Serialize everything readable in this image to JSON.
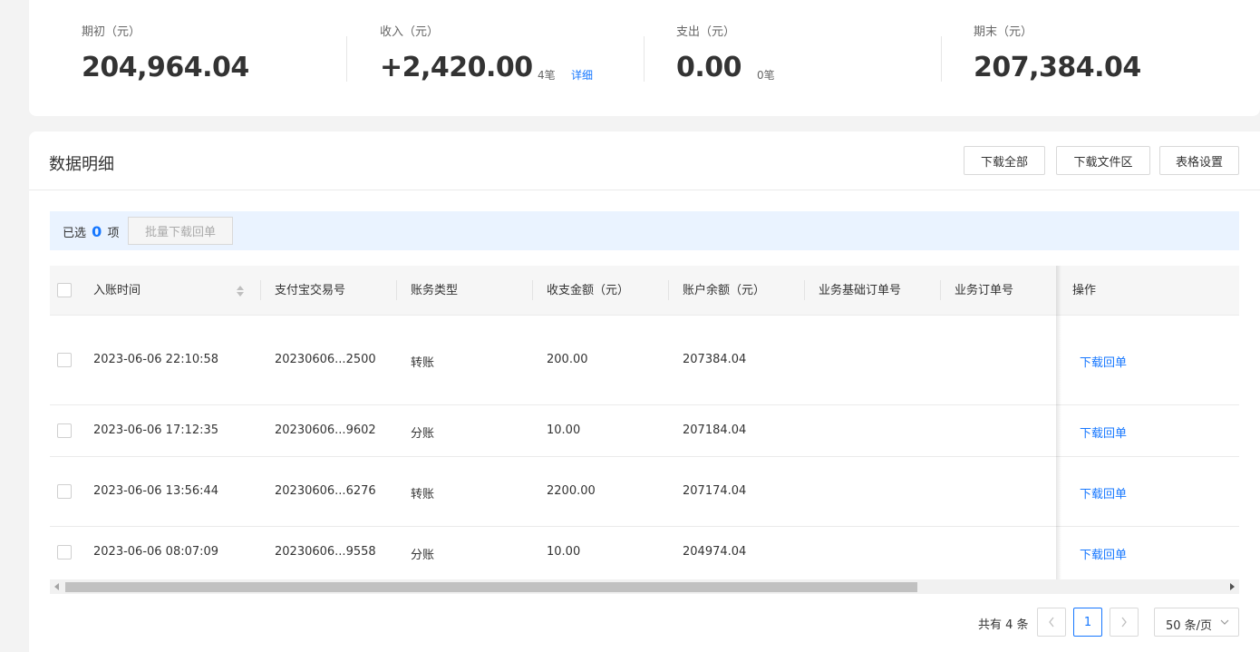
{
  "summary": [
    {
      "label": "期初（元）",
      "value": "204,964.04"
    },
    {
      "label": "收入（元）",
      "value": "+2,420.00",
      "count": "4笔",
      "detail": "详细"
    },
    {
      "label": "支出（元）",
      "value": "0.00",
      "count": "0笔"
    },
    {
      "label": "期末（元）",
      "value": "207,384.04"
    }
  ],
  "section": {
    "title": "数据明细",
    "buttons": [
      "下载全部",
      "下载文件区",
      "表格设置"
    ]
  },
  "selection": {
    "prefix": "已选",
    "count": "0",
    "suffix": "项",
    "batch_button": "批量下载回单"
  },
  "table": {
    "columns": [
      "入账时间",
      "支付宝交易号",
      "账务类型",
      "收支金额（元）",
      "账户余额（元）",
      "业务基础订单号",
      "业务订单号",
      "操作"
    ],
    "rows": [
      {
        "time": "2023-06-06 22:10:58",
        "trade_no": "20230606...2500",
        "type": "转账",
        "amount": "200.00",
        "balance": "207384.04",
        "base_order": "",
        "order": "",
        "action": "下载回单"
      },
      {
        "time": "2023-06-06 17:12:35",
        "trade_no": "20230606...9602",
        "type": "分账",
        "amount": "10.00",
        "balance": "207184.04",
        "base_order": "",
        "order": "",
        "action": "下载回单"
      },
      {
        "time": "2023-06-06 13:56:44",
        "trade_no": "20230606...6276",
        "type": "转账",
        "amount": "2200.00",
        "balance": "207174.04",
        "base_order": "",
        "order": "",
        "action": "下载回单"
      },
      {
        "time": "2023-06-06 08:07:09",
        "trade_no": "20230606...9558",
        "type": "分账",
        "amount": "10.00",
        "balance": "204974.04",
        "base_order": "",
        "order": "",
        "action": "下载回单"
      }
    ]
  },
  "pagination": {
    "total": "共有 4 条",
    "current_page": "1",
    "page_size": "50 条/页"
  },
  "colors": {
    "accent": "#1677ff",
    "selection_bg": "#eaf3ff",
    "header_bg": "#f6f6f6"
  }
}
